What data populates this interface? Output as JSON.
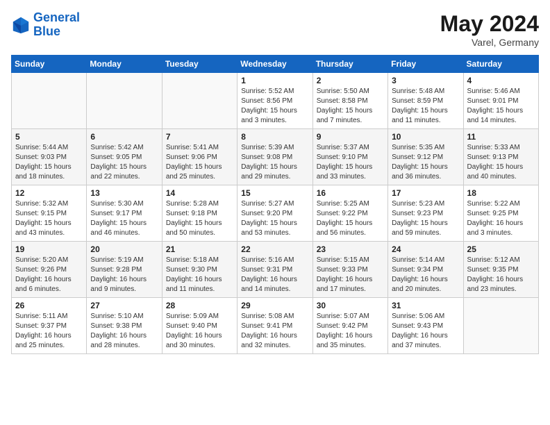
{
  "header": {
    "logo_line1": "General",
    "logo_line2": "Blue",
    "month": "May 2024",
    "location": "Varel, Germany"
  },
  "days_of_week": [
    "Sunday",
    "Monday",
    "Tuesday",
    "Wednesday",
    "Thursday",
    "Friday",
    "Saturday"
  ],
  "weeks": [
    [
      {
        "day": "",
        "info": ""
      },
      {
        "day": "",
        "info": ""
      },
      {
        "day": "",
        "info": ""
      },
      {
        "day": "1",
        "info": "Sunrise: 5:52 AM\nSunset: 8:56 PM\nDaylight: 15 hours\nand 3 minutes."
      },
      {
        "day": "2",
        "info": "Sunrise: 5:50 AM\nSunset: 8:58 PM\nDaylight: 15 hours\nand 7 minutes."
      },
      {
        "day": "3",
        "info": "Sunrise: 5:48 AM\nSunset: 8:59 PM\nDaylight: 15 hours\nand 11 minutes."
      },
      {
        "day": "4",
        "info": "Sunrise: 5:46 AM\nSunset: 9:01 PM\nDaylight: 15 hours\nand 14 minutes."
      }
    ],
    [
      {
        "day": "5",
        "info": "Sunrise: 5:44 AM\nSunset: 9:03 PM\nDaylight: 15 hours\nand 18 minutes."
      },
      {
        "day": "6",
        "info": "Sunrise: 5:42 AM\nSunset: 9:05 PM\nDaylight: 15 hours\nand 22 minutes."
      },
      {
        "day": "7",
        "info": "Sunrise: 5:41 AM\nSunset: 9:06 PM\nDaylight: 15 hours\nand 25 minutes."
      },
      {
        "day": "8",
        "info": "Sunrise: 5:39 AM\nSunset: 9:08 PM\nDaylight: 15 hours\nand 29 minutes."
      },
      {
        "day": "9",
        "info": "Sunrise: 5:37 AM\nSunset: 9:10 PM\nDaylight: 15 hours\nand 33 minutes."
      },
      {
        "day": "10",
        "info": "Sunrise: 5:35 AM\nSunset: 9:12 PM\nDaylight: 15 hours\nand 36 minutes."
      },
      {
        "day": "11",
        "info": "Sunrise: 5:33 AM\nSunset: 9:13 PM\nDaylight: 15 hours\nand 40 minutes."
      }
    ],
    [
      {
        "day": "12",
        "info": "Sunrise: 5:32 AM\nSunset: 9:15 PM\nDaylight: 15 hours\nand 43 minutes."
      },
      {
        "day": "13",
        "info": "Sunrise: 5:30 AM\nSunset: 9:17 PM\nDaylight: 15 hours\nand 46 minutes."
      },
      {
        "day": "14",
        "info": "Sunrise: 5:28 AM\nSunset: 9:18 PM\nDaylight: 15 hours\nand 50 minutes."
      },
      {
        "day": "15",
        "info": "Sunrise: 5:27 AM\nSunset: 9:20 PM\nDaylight: 15 hours\nand 53 minutes."
      },
      {
        "day": "16",
        "info": "Sunrise: 5:25 AM\nSunset: 9:22 PM\nDaylight: 15 hours\nand 56 minutes."
      },
      {
        "day": "17",
        "info": "Sunrise: 5:23 AM\nSunset: 9:23 PM\nDaylight: 15 hours\nand 59 minutes."
      },
      {
        "day": "18",
        "info": "Sunrise: 5:22 AM\nSunset: 9:25 PM\nDaylight: 16 hours\nand 3 minutes."
      }
    ],
    [
      {
        "day": "19",
        "info": "Sunrise: 5:20 AM\nSunset: 9:26 PM\nDaylight: 16 hours\nand 6 minutes."
      },
      {
        "day": "20",
        "info": "Sunrise: 5:19 AM\nSunset: 9:28 PM\nDaylight: 16 hours\nand 9 minutes."
      },
      {
        "day": "21",
        "info": "Sunrise: 5:18 AM\nSunset: 9:30 PM\nDaylight: 16 hours\nand 11 minutes."
      },
      {
        "day": "22",
        "info": "Sunrise: 5:16 AM\nSunset: 9:31 PM\nDaylight: 16 hours\nand 14 minutes."
      },
      {
        "day": "23",
        "info": "Sunrise: 5:15 AM\nSunset: 9:33 PM\nDaylight: 16 hours\nand 17 minutes."
      },
      {
        "day": "24",
        "info": "Sunrise: 5:14 AM\nSunset: 9:34 PM\nDaylight: 16 hours\nand 20 minutes."
      },
      {
        "day": "25",
        "info": "Sunrise: 5:12 AM\nSunset: 9:35 PM\nDaylight: 16 hours\nand 23 minutes."
      }
    ],
    [
      {
        "day": "26",
        "info": "Sunrise: 5:11 AM\nSunset: 9:37 PM\nDaylight: 16 hours\nand 25 minutes."
      },
      {
        "day": "27",
        "info": "Sunrise: 5:10 AM\nSunset: 9:38 PM\nDaylight: 16 hours\nand 28 minutes."
      },
      {
        "day": "28",
        "info": "Sunrise: 5:09 AM\nSunset: 9:40 PM\nDaylight: 16 hours\nand 30 minutes."
      },
      {
        "day": "29",
        "info": "Sunrise: 5:08 AM\nSunset: 9:41 PM\nDaylight: 16 hours\nand 32 minutes."
      },
      {
        "day": "30",
        "info": "Sunrise: 5:07 AM\nSunset: 9:42 PM\nDaylight: 16 hours\nand 35 minutes."
      },
      {
        "day": "31",
        "info": "Sunrise: 5:06 AM\nSunset: 9:43 PM\nDaylight: 16 hours\nand 37 minutes."
      },
      {
        "day": "",
        "info": ""
      }
    ]
  ]
}
